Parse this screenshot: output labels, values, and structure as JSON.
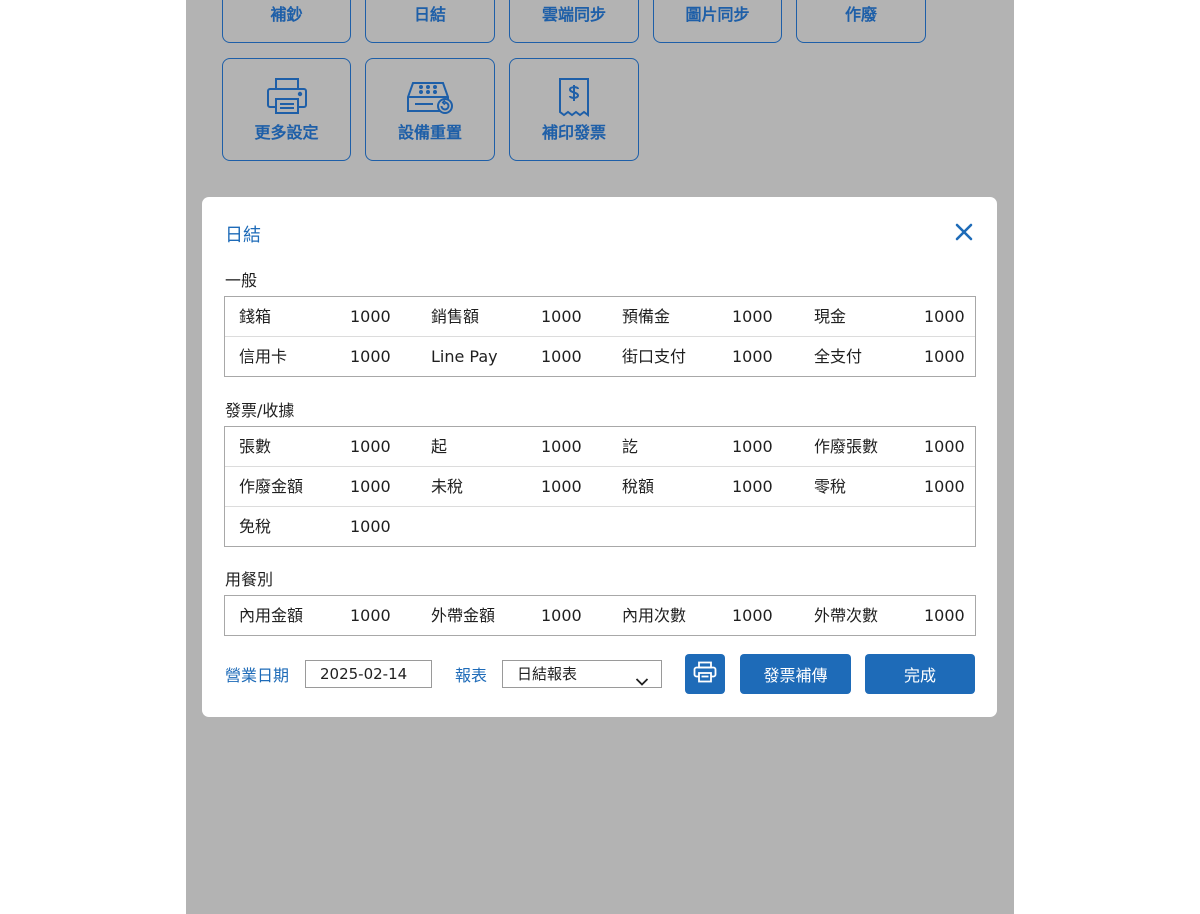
{
  "menu": {
    "top_row": [
      "補鈔",
      "日結",
      "雲端同步",
      "圖片同步",
      "作廢"
    ],
    "second_row": [
      {
        "label": "更多設定",
        "icon": "printer-icon"
      },
      {
        "label": "設備重置",
        "icon": "device-reset-icon"
      },
      {
        "label": "補印發票",
        "icon": "receipt-icon"
      }
    ]
  },
  "dialog": {
    "title": "日結",
    "sections": [
      {
        "title": "一般",
        "rows": [
          [
            {
              "label": "錢箱",
              "value": "1000"
            },
            {
              "label": "銷售額",
              "value": "1000"
            },
            {
              "label": "預備金",
              "value": "1000"
            },
            {
              "label": "現金",
              "value": "1000"
            }
          ],
          [
            {
              "label": "信用卡",
              "value": "1000"
            },
            {
              "label": "Line Pay",
              "value": "1000"
            },
            {
              "label": "街口支付",
              "value": "1000"
            },
            {
              "label": "全支付",
              "value": "1000"
            }
          ]
        ]
      },
      {
        "title": "發票/收據",
        "rows": [
          [
            {
              "label": "張數",
              "value": "1000"
            },
            {
              "label": "起",
              "value": "1000"
            },
            {
              "label": "訖",
              "value": "1000"
            },
            {
              "label": "作廢張數",
              "value": "1000"
            }
          ],
          [
            {
              "label": "作廢金額",
              "value": "1000"
            },
            {
              "label": "未稅",
              "value": "1000"
            },
            {
              "label": "稅額",
              "value": "1000"
            },
            {
              "label": "零稅",
              "value": "1000"
            }
          ],
          [
            {
              "label": "免稅",
              "value": "1000"
            }
          ]
        ]
      },
      {
        "title": "用餐別",
        "rows": [
          [
            {
              "label": "內用金額",
              "value": "1000"
            },
            {
              "label": "外帶金額",
              "value": "1000"
            },
            {
              "label": "內用次數",
              "value": "1000"
            },
            {
              "label": "外帶次數",
              "value": "1000"
            }
          ]
        ]
      }
    ],
    "footer": {
      "business_date_label": "營業日期",
      "business_date_value": "2025-02-14",
      "report_label": "報表",
      "report_selected": "日結報表",
      "invoice_resend_label": "發票補傳",
      "done_label": "完成"
    }
  },
  "colors": {
    "accent": "#1e6bb8",
    "overlay_gray": "#b3b3b3"
  }
}
